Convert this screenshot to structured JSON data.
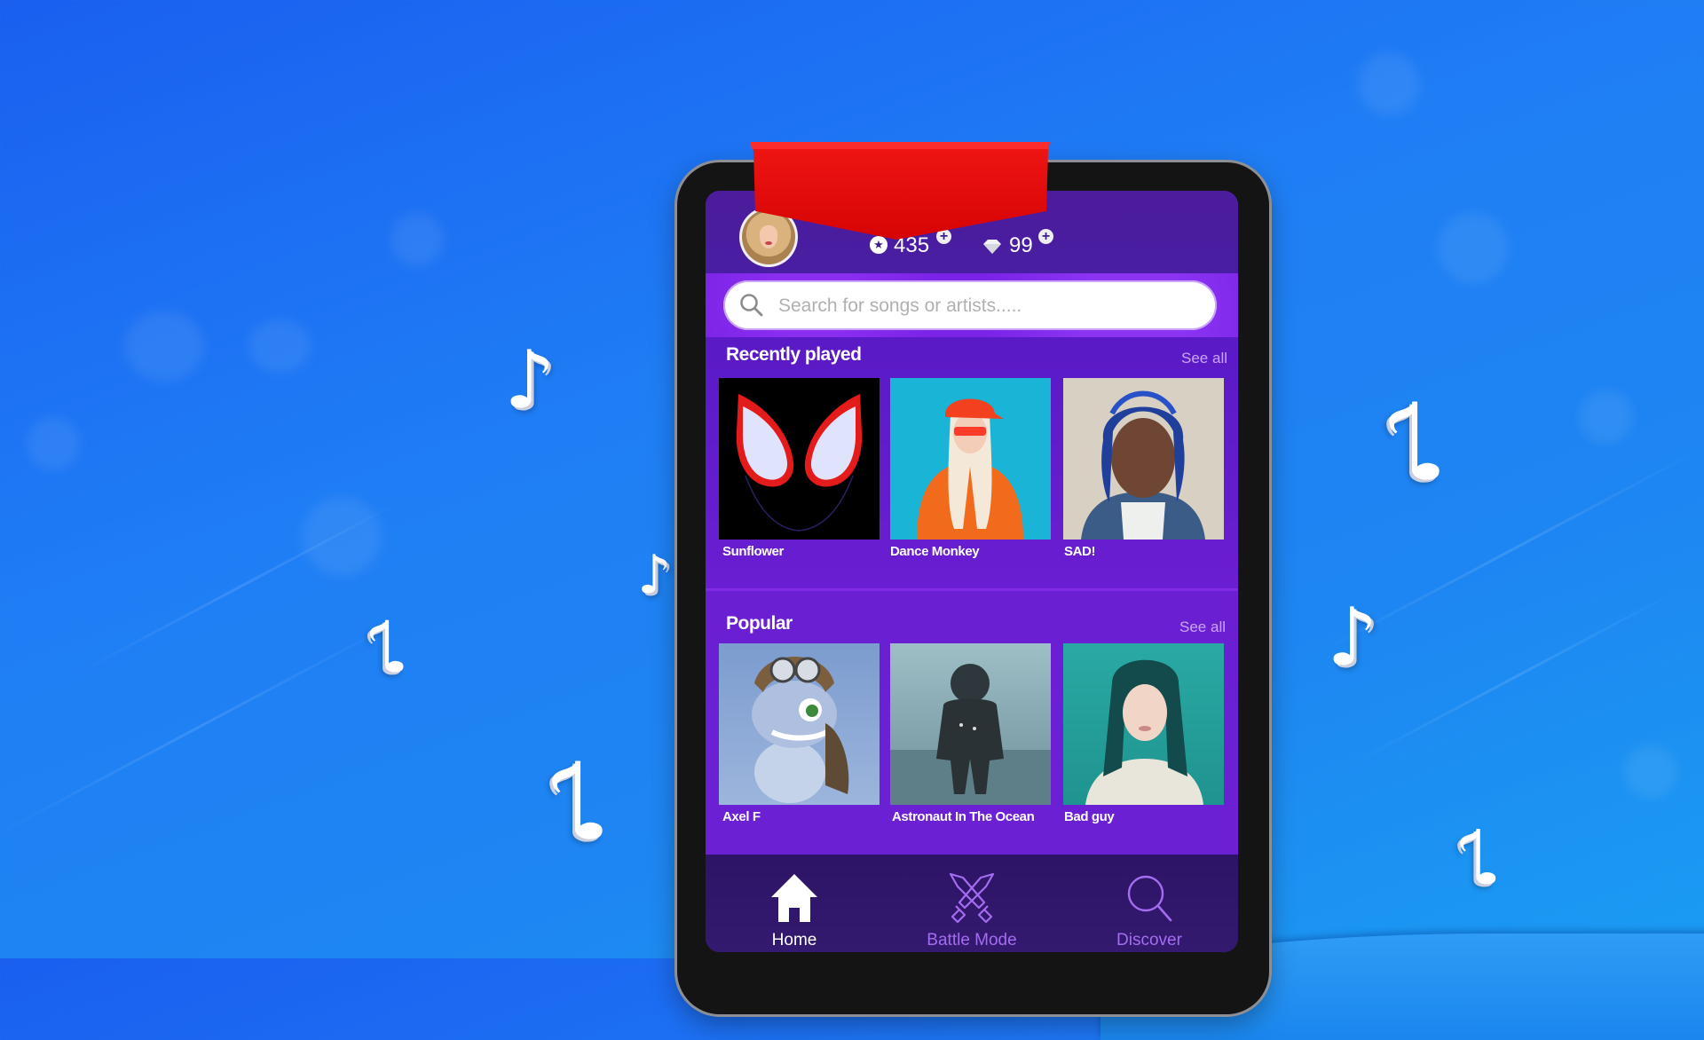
{
  "app": {
    "profile": {
      "avatar_alt": "User avatar"
    },
    "currency": {
      "coins": "435",
      "gems": "99"
    },
    "search": {
      "placeholder": "Search for songs or artists....."
    },
    "sections": [
      {
        "title": "Recently played",
        "see_all": "See all",
        "items": [
          {
            "title": "Sunflower",
            "art": "spider-mask"
          },
          {
            "title": "Dance Monkey",
            "art": "orange-hoodie-artist"
          },
          {
            "title": "SAD!",
            "art": "blue-dreads-artist"
          }
        ]
      },
      {
        "title": "Popular",
        "see_all": "See all",
        "items": [
          {
            "title": "Axel F",
            "art": "crazy-frog"
          },
          {
            "title": "Astronaut In The Ocean",
            "art": "astronaut"
          },
          {
            "title": "Bad guy",
            "art": "teal-hair-artist"
          }
        ]
      }
    ],
    "nav": [
      {
        "label": "Home",
        "icon": "home-icon",
        "active": true
      },
      {
        "label": "Battle Mode",
        "icon": "crossed-swords-icon",
        "active": false
      },
      {
        "label": "Discover",
        "icon": "search-icon",
        "active": false
      }
    ],
    "colors": {
      "accent": "#7a22e6",
      "nav_active": "#ffffff",
      "nav_inactive": "#a46cf0",
      "ribbon": "#e0060b"
    }
  }
}
